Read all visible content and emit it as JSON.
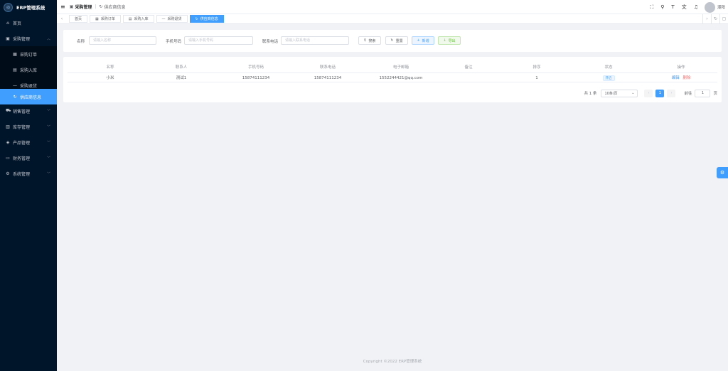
{
  "app": {
    "title": "ERP管理系统"
  },
  "sidebar": {
    "items": [
      {
        "label": "首页",
        "icon": "home-icon"
      },
      {
        "label": "采购管理",
        "icon": "purchase-icon"
      },
      {
        "label": "采购订单",
        "icon": "table-icon"
      },
      {
        "label": "采购入库",
        "icon": "warehouse-icon"
      },
      {
        "label": "采购退货",
        "icon": "dash-icon"
      },
      {
        "label": "供应商信息",
        "icon": "refresh-icon"
      },
      {
        "label": "销售管理",
        "icon": "truck-icon"
      },
      {
        "label": "库存管理",
        "icon": "box-icon"
      },
      {
        "label": "产品管理",
        "icon": "product-icon"
      },
      {
        "label": "财务管理",
        "icon": "money-icon"
      },
      {
        "label": "系统管理",
        "icon": "gear-icon"
      }
    ]
  },
  "header": {
    "breadcrumb": [
      "采购管理",
      "供应商信息"
    ],
    "username": "潮阳"
  },
  "tags": [
    {
      "label": "首页"
    },
    {
      "label": "采购订单"
    },
    {
      "label": "采购入库"
    },
    {
      "label": "采购退货"
    },
    {
      "label": "供应商信息"
    }
  ],
  "search": {
    "name_label": "名称",
    "name_placeholder": "请输入名称",
    "phone_label": "手机号码",
    "phone_placeholder": "请输入手机号码",
    "tel_label": "联系电话",
    "tel_placeholder": "请输入联系电话",
    "search_btn": "搜索",
    "reset_btn": "重置",
    "add_btn": "新增",
    "export_btn": "导出"
  },
  "table": {
    "columns": [
      "名称",
      "联系人",
      "手机号码",
      "联系电话",
      "电子邮箱",
      "备注",
      "排序",
      "状态",
      "操作"
    ],
    "rows": [
      {
        "name": "小米",
        "contact": "测试1",
        "mobile": "15874111234",
        "tel": "15874111234",
        "email": "1552244421@qq.com",
        "remark": "",
        "sort": "1",
        "status": "开启",
        "edit": "编辑",
        "delete": "删除"
      }
    ]
  },
  "pagination": {
    "total": "共 1 条",
    "page_size": "10条/页",
    "current": "1",
    "goto_label": "前往",
    "goto_value": "1",
    "page_unit": "页"
  },
  "footer": {
    "text": "Copyright ©2022 ERP管理系统"
  }
}
